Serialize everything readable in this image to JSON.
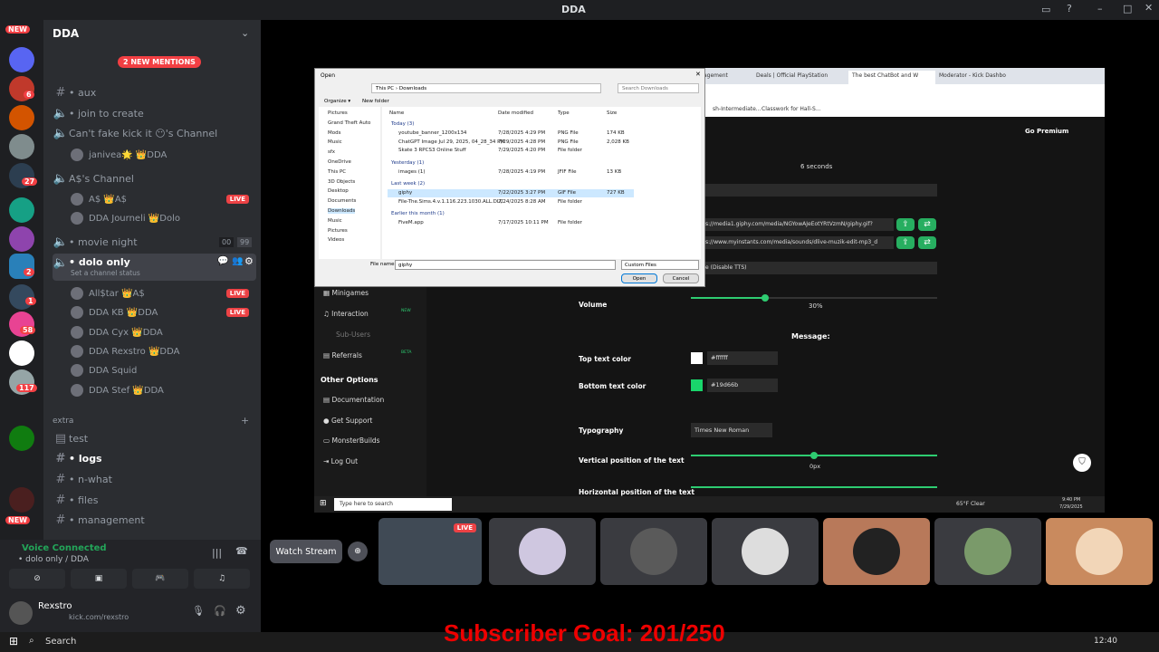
{
  "window": {
    "title": "DDA"
  },
  "servers": {
    "new_top": "NEW",
    "new_bottom": "NEW",
    "badges": [
      "6",
      "27",
      "2",
      "1",
      "58",
      "117"
    ]
  },
  "sidebar": {
    "server_name": "DDA",
    "new_mentions": "2 NEW MENTIONS",
    "channels": [
      {
        "name": "• aux",
        "type": "text"
      },
      {
        "name": "• join to create",
        "type": "voice"
      },
      {
        "name": "Can't fake kick it 😶's Channel",
        "type": "voice"
      },
      {
        "name": "A$'s Channel",
        "type": "voice"
      },
      {
        "name": "• movie night",
        "type": "voice",
        "counts": [
          "00",
          "99"
        ]
      },
      {
        "name": "• dolo only",
        "type": "voice",
        "status": "Set a channel status"
      }
    ],
    "aschannel_users": [
      {
        "name": "A$ 👑A$",
        "live": "LIVE"
      },
      {
        "name": "DDA Journeli 👑Dolo"
      }
    ],
    "cantfake_user": "janivea🌟 👑DDA",
    "dolo_users": [
      {
        "name": "All$tar 👑A$",
        "live": "LIVE"
      },
      {
        "name": "DDA KB 👑DDA",
        "live": "LIVE"
      },
      {
        "name": "DDA Cyx 👑DDA"
      },
      {
        "name": "DDA Rexstro 👑DDA"
      },
      {
        "name": "DDA Squid"
      },
      {
        "name": "DDA Stef 👑DDA"
      }
    ],
    "category_extra": "extra",
    "extra_channels": [
      "test",
      "• logs",
      "• n-what",
      "• files",
      "• management"
    ]
  },
  "voice": {
    "status": "Voice Connected",
    "location": "• dolo only / DDA"
  },
  "user": {
    "name": "Rexstro",
    "sub": "kick.com/rexstro"
  },
  "dialog": {
    "title": "Open",
    "path": [
      "This PC",
      "Downloads"
    ],
    "search": "Search Downloads",
    "organize": "Organize ▾",
    "new_folder": "New folder",
    "cols": [
      "Name",
      "Date modified",
      "Type",
      "Size"
    ],
    "nav": [
      "Pictures",
      "Grand Theft Auto",
      "Mods",
      "Music",
      "sfx",
      "OneDrive",
      "This PC",
      "3D Objects",
      "Desktop",
      "Documents",
      "Downloads",
      "Music",
      "Pictures",
      "Videos"
    ],
    "groups": [
      {
        "label": "Today (3)",
        "files": [
          [
            "youtube_banner_1200x134",
            "7/28/2025 4:29 PM",
            "PNG File",
            "174 KB"
          ],
          [
            "ChatGPT Image Jul 29, 2025, 04_28_34 PM",
            "7/29/2025 4:28 PM",
            "PNG File",
            "2,028 KB"
          ],
          [
            "Skate 3 RPCS3 Online Stuff",
            "7/29/2025 4:20 PM",
            "File folder",
            ""
          ]
        ]
      },
      {
        "label": "Yesterday (1)",
        "files": [
          [
            "images (1)",
            "7/28/2025 4:19 PM",
            "JFIF File",
            "13 KB"
          ]
        ]
      },
      {
        "label": "Last week (2)",
        "files": [
          [
            "giphy",
            "7/22/2025 3:27 PM",
            "GIF File",
            "727 KB"
          ],
          [
            "File-The.Sims.4.v.1.116.223.1030.ALL.DLC",
            "7/24/2025 8:28 AM",
            "File folder",
            ""
          ]
        ]
      },
      {
        "label": "Earlier this month (1)",
        "files": [
          [
            "FiveM.app",
            "7/17/2025 10:11 PM",
            "File folder",
            ""
          ]
        ]
      }
    ],
    "filename_label": "File name:",
    "filename": "giphy",
    "filter": "Custom Files",
    "open": "Open",
    "cancel": "Cancel"
  },
  "browser": {
    "tabs": [
      "agement",
      "Deals | Official PlayStation",
      "The best ChatBot and W",
      "Moderator - Kick Dashbo"
    ],
    "bookmarks": [
      "sh-Intermediate...",
      "Classwork for Hall-S..."
    ]
  },
  "app": {
    "premium": "Go Premium",
    "seconds": "6 seconds",
    "url1": "s://media1.giphy.com/media/NGYowAJeEotYRtVzmN/giphy.gif?",
    "url2": "s://www.myinstants.com/media/sounds/dlive-muzik-edit-mp3_d",
    "tts": "e (Disable TTS)",
    "menu": [
      "Minigames",
      "Interaction",
      "Sub-Users",
      "Referrals"
    ],
    "new_tag": "NEW",
    "beta_tag": "BETA",
    "other_options": "Other Options",
    "other": [
      "Documentation",
      "Get Support",
      "MonsterBuilds",
      "Log Out"
    ],
    "volume_label": "Volume",
    "volume_value": "30%",
    "volume_level": 0.3,
    "message": "Message:",
    "top_color_label": "Top text color",
    "top_color": "#ffffff",
    "bottom_color_label": "Bottom text color",
    "bottom_color": "#19d66b",
    "typography_label": "Typography",
    "typography": "Times New Roman",
    "vpos_label": "Vertical position of the text",
    "vpos": "0px",
    "hpos_label": "Horizontal position of the text"
  },
  "taskbar_inner": {
    "search": "Type here to search",
    "weather": "65°F Clear",
    "time": "9:40 PM",
    "date": "7/29/2025"
  },
  "stream": {
    "watch": "Watch Stream",
    "live": "LIVE"
  },
  "goal": "Subscriber Goal: 201/250",
  "win_taskbar": {
    "search": "Search",
    "time": "12:40"
  },
  "colors": {
    "accent": "#2ecc71",
    "live": "#ed4245",
    "bg": "#1e1f22"
  }
}
